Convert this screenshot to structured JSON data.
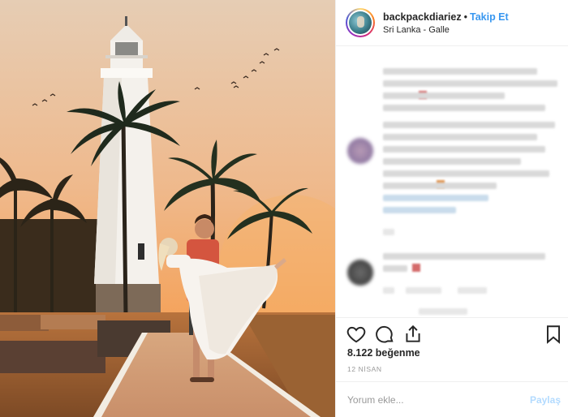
{
  "photo": {
    "description_icon": "lighthouse-couple-photo"
  },
  "header": {
    "username": "backpackdiariez",
    "separator": "•",
    "follow_label": "Takip Et",
    "location": "Sri Lanka - Galle"
  },
  "actions": {
    "like_icon": "heart-icon",
    "comment_icon": "comment-icon",
    "share_icon": "share-icon",
    "save_icon": "bookmark-icon"
  },
  "stats": {
    "likes": "8.122 beğenme",
    "date": "12 NİSAN"
  },
  "comment_form": {
    "placeholder": "Yorum ekle...",
    "post_label": "Paylaş"
  },
  "colors": {
    "accent": "#3897f0",
    "post_disabled": "#b3dbff",
    "sky_top": "#e7c7a9",
    "sky_bottom": "#f2a25a"
  }
}
